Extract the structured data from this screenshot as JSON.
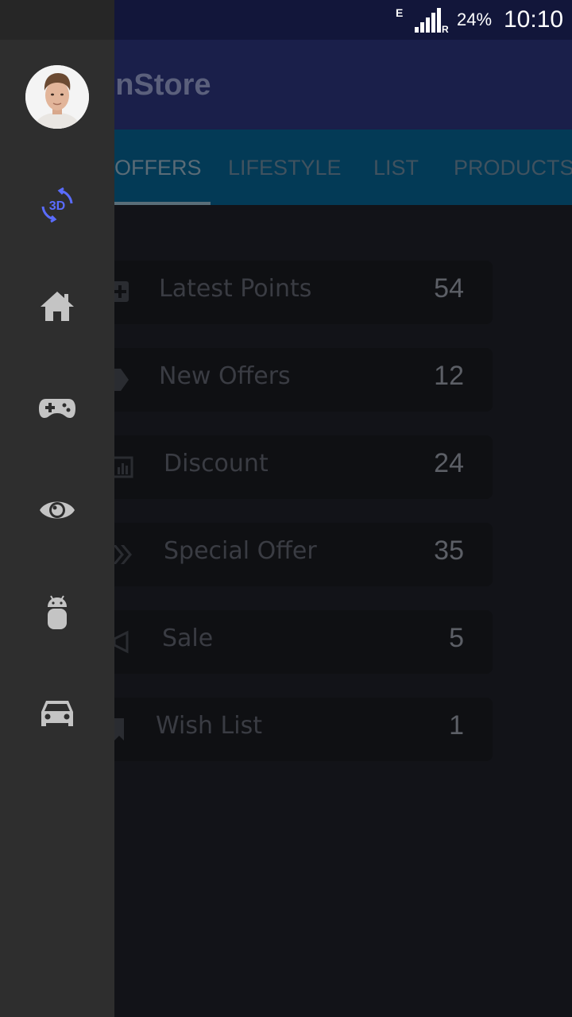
{
  "status_bar": {
    "network_type": "E",
    "roaming": "R",
    "battery": "24%",
    "time": "10:10"
  },
  "app_bar": {
    "title_visible": "onStore"
  },
  "tabs": [
    {
      "label": "OFFERS",
      "active": true
    },
    {
      "label": "LIFESTYLE",
      "active": false
    },
    {
      "label": "LIST",
      "active": false
    },
    {
      "label": "PRODUCTS",
      "active": false
    }
  ],
  "list": [
    {
      "label": "Latest Points",
      "count": "54",
      "icon": "plus-box-icon"
    },
    {
      "label": "New Offers",
      "count": "12",
      "icon": "tag-icon"
    },
    {
      "label": "Discount",
      "count": "24",
      "icon": "bar-chart-icon"
    },
    {
      "label": "Special Offer",
      "count": "35",
      "icon": "double-chevron-icon"
    },
    {
      "label": "Sale",
      "count": "5",
      "icon": "megaphone-icon"
    },
    {
      "label": "Wish List",
      "count": "1",
      "icon": "bookmark-icon"
    }
  ],
  "drawer": {
    "items": [
      {
        "icon": "rotate-3d-icon",
        "text": "3D"
      },
      {
        "icon": "home-icon"
      },
      {
        "icon": "gamepad-icon"
      },
      {
        "icon": "eye-icon"
      },
      {
        "icon": "android-icon"
      },
      {
        "icon": "car-icon"
      }
    ]
  },
  "colors": {
    "accent": "#5a6cff",
    "drawer_bg": "#2e2e2e",
    "tab_bar": "#033a56",
    "app_bar": "#1a1f4a"
  }
}
